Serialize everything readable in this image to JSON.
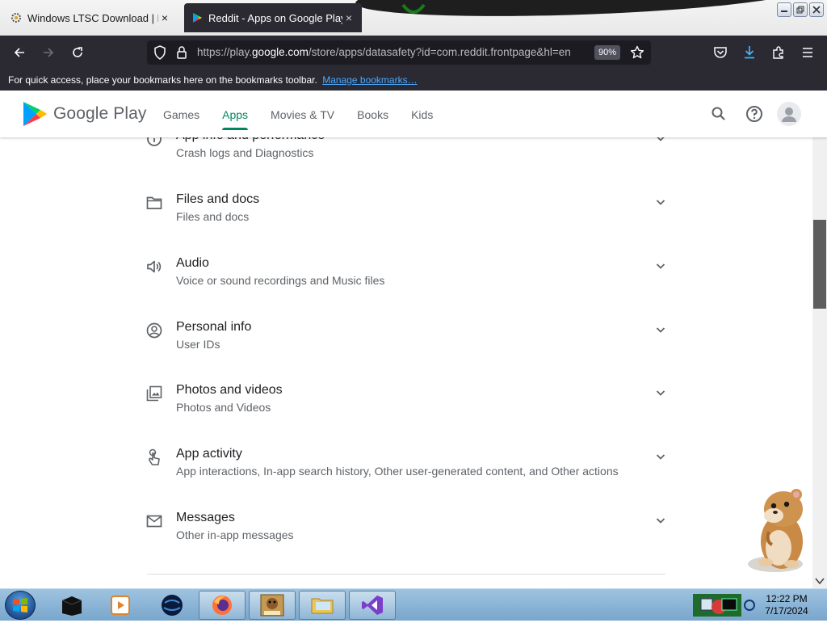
{
  "browser": {
    "tabs": [
      {
        "title": "Windows LTSC Download | MAS",
        "active": false,
        "close": "×",
        "favicon": "gear-favicon-icon"
      },
      {
        "title": "Reddit - Apps on Google Play",
        "active": true,
        "close": "×",
        "favicon": "google-play-favicon-icon"
      }
    ],
    "url_prefix": "https://play.",
    "url_domain": "google.com",
    "url_rest": "/store/apps/datasafety?id=com.reddit.frontpage&hl=en",
    "zoom": "90%",
    "bookmarks_text": "For quick access, place your bookmarks here on the bookmarks toolbar.",
    "bookmarks_link": "Manage bookmarks…"
  },
  "play_header": {
    "brand": "Google Play",
    "nav": [
      {
        "label": "Games",
        "active": false
      },
      {
        "label": "Apps",
        "active": true
      },
      {
        "label": "Movies & TV",
        "active": false
      },
      {
        "label": "Books",
        "active": false
      },
      {
        "label": "Kids",
        "active": false
      }
    ]
  },
  "data_sections": [
    {
      "title": "App info and performance",
      "subtitle": "Crash logs and Diagnostics",
      "icon": "info-icon"
    },
    {
      "title": "Files and docs",
      "subtitle": "Files and docs",
      "icon": "folder-icon"
    },
    {
      "title": "Audio",
      "subtitle": "Voice or sound recordings and Music files",
      "icon": "speaker-icon"
    },
    {
      "title": "Personal info",
      "subtitle": "User IDs",
      "icon": "person-icon"
    },
    {
      "title": "Photos and videos",
      "subtitle": "Photos and Videos",
      "icon": "photos-icon"
    },
    {
      "title": "App activity",
      "subtitle": "App interactions, In-app search history, Other user-generated content, and Other actions",
      "icon": "touch-icon"
    },
    {
      "title": "Messages",
      "subtitle": "Other in-app messages",
      "icon": "mail-icon"
    }
  ],
  "taskbar": {
    "time": "12:22 PM",
    "date": "7/17/2024",
    "apps": [
      "terminal-app-icon",
      "media-player-app-icon",
      "globe-app-icon",
      "firefox-app-icon",
      "box-app-icon",
      "explorer-app-icon",
      "visual-studio-app-icon"
    ]
  },
  "colors": {
    "play_green": "#01875f",
    "browser_dark": "#2b2a33",
    "link_blue": "#4aa8ff"
  }
}
